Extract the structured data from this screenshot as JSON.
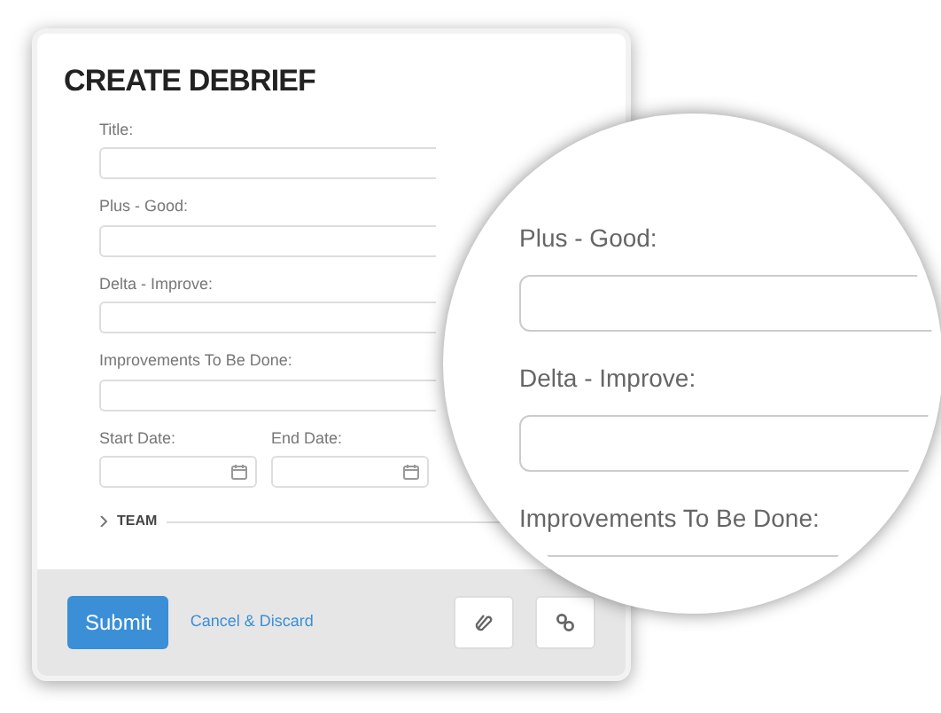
{
  "form": {
    "title": "CREATE DEBRIEF",
    "fields": [
      {
        "label": "Title:"
      },
      {
        "label": "Plus - Good:"
      },
      {
        "label": "Delta - Improve:"
      },
      {
        "label": "Improvements To Be Done:"
      }
    ],
    "date_fields": [
      {
        "label": "Start Date:"
      },
      {
        "label": "End Date:"
      }
    ],
    "team_section": {
      "label": "TEAM",
      "expanded": false
    },
    "footer": {
      "submit": "Submit",
      "cancel": "Cancel & Discard"
    }
  },
  "magnifier": {
    "fields": [
      {
        "label": "Plus - Good:"
      },
      {
        "label": "Delta - Improve:"
      },
      {
        "label": "Improvements To Be Done:"
      }
    ]
  }
}
